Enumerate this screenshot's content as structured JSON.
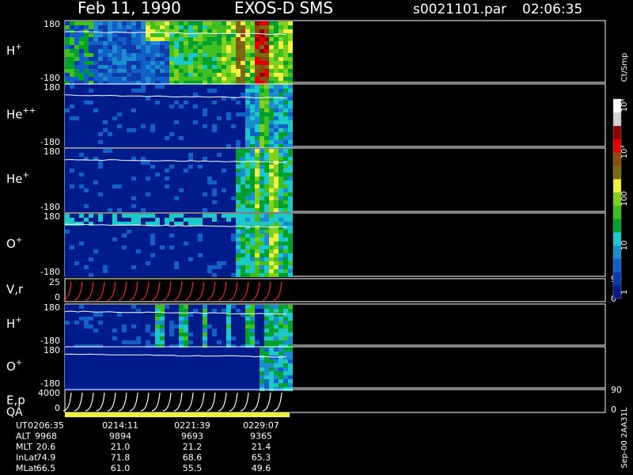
{
  "header": {
    "date": "Feb 11, 1990",
    "instrument": "EXOS-D SMS",
    "file": "s0021101.par",
    "time": "02:06:35"
  },
  "colorbar": {
    "unit": "Ct/Smp",
    "tick_labels": [
      "1",
      "10",
      "100",
      "10³",
      "10⁴"
    ],
    "colors": [
      "#001c8a",
      "#0c3aa8",
      "#1060c8",
      "#1c8ccc",
      "#1cc8c8",
      "#00a030",
      "#40c020",
      "#80d020",
      "#f0f040",
      "#7a6a10",
      "#8a4a10",
      "#e00000",
      "#900000",
      "#d0d0d0",
      "#ffffff"
    ]
  },
  "footer_code": "Sep-00 2AA31L",
  "chart_data": {
    "type": "heatmap",
    "x_time_labels": [
      "0206:35",
      "0214:11",
      "0221:39",
      "0229:07"
    ],
    "panels": [
      {
        "label": "H",
        "sup": "+",
        "ymin": "-180",
        "ymax": "180",
        "profile": "H"
      },
      {
        "label": "He",
        "sup": "++",
        "ymin": "-180",
        "ymax": "180",
        "profile": "He2"
      },
      {
        "label": "He",
        "sup": "+",
        "ymin": "-180",
        "ymax": "180",
        "profile": "He1"
      },
      {
        "label": "O",
        "sup": "+",
        "ymin": "-180",
        "ymax": "180",
        "profile": "O"
      },
      {
        "label": "V,r",
        "sup": "",
        "ymin": "0",
        "ymax": "25",
        "right_top": "90",
        "right_bottom": "0",
        "profile": "Vr"
      },
      {
        "label": "H",
        "sup": "+",
        "ymin": "-180",
        "ymax": "180",
        "profile": "H2"
      },
      {
        "label": "O",
        "sup": "+",
        "ymin": "-180",
        "ymax": "180",
        "profile": "O2"
      },
      {
        "label": "E,p",
        "sup": "",
        "ymin": "0",
        "ymax": "4000",
        "right_top": "90",
        "right_bottom": "0",
        "profile": "Ep"
      }
    ],
    "qa_label": "QA",
    "orbit_table": {
      "rows": [
        {
          "name": "UT",
          "values": [
            "0206:35",
            "0214:11",
            "0221:39",
            "0229:07"
          ]
        },
        {
          "name": "ALT",
          "values": [
            "9968",
            "9894",
            "9693",
            "9365"
          ]
        },
        {
          "name": "MLT",
          "values": [
            "20.6",
            "21.0",
            "21.2",
            "21.4"
          ]
        },
        {
          "name": "InLat",
          "values": [
            "74.9",
            "71.8",
            "68.6",
            "65.3"
          ]
        },
        {
          "name": "MLat",
          "values": [
            "66.5",
            "61.0",
            "55.5",
            "49.6"
          ]
        }
      ]
    }
  }
}
